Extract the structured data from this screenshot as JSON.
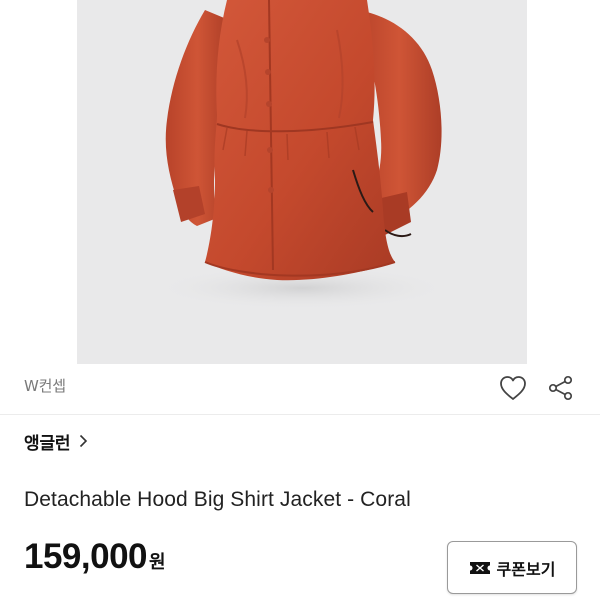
{
  "product": {
    "store_name": "W컨셉",
    "brand_name": "앵글런",
    "title": "Detachable Hood Big Shirt Jacket - Coral",
    "price_amount": "159,000",
    "price_unit": "원"
  },
  "actions": {
    "coupon_label": "쿠폰보기"
  },
  "icons": {
    "wishlist": "heart-icon",
    "share": "share-icon",
    "brand": "chevron-right-icon",
    "coupon": "coupon-icon"
  },
  "colors": {
    "jacket": "#c4492d",
    "image_background": "#e9e9ea",
    "divider": "#ececec"
  }
}
